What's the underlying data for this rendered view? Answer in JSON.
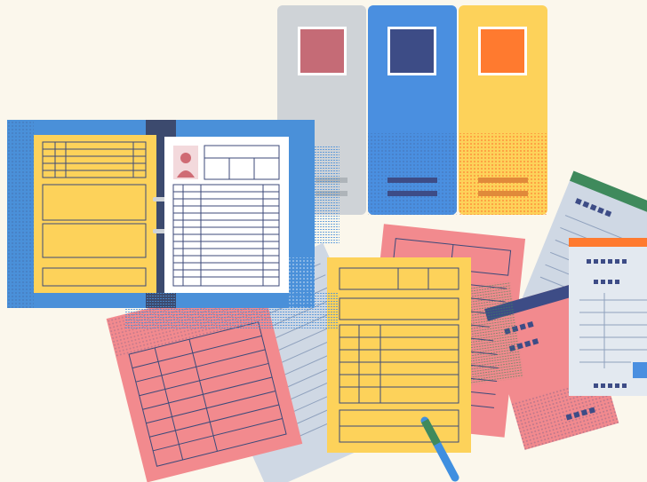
{
  "illustration": {
    "subject": "paperwork",
    "colors": {
      "background": "#fbf7ec",
      "binder_blue": "#4a90d9",
      "binder_dark": "#3c4a6e",
      "folder_gray": "#cfd3d7",
      "folder_blue": "#4a8fe0",
      "folder_yellow": "#fdd25a",
      "sheet_pink": "#f28a8e",
      "sheet_yellow": "#fdd25a",
      "sheet_gray": "#cfd8e4",
      "sheet_white": "#ffffff",
      "line_navy": "#3c4a7a",
      "accent_red": "#cf6b74",
      "accent_navy": "#3d4c86",
      "accent_orange": "#ff7a2f",
      "accent_green": "#3f8a5c",
      "pen_blue": "#3f8fe0"
    },
    "objects": [
      "folder-gray",
      "folder-blue",
      "folder-yellow",
      "open-binder",
      "form-yellow",
      "form-pink",
      "form-gray",
      "ticket-green",
      "ticket-orange",
      "pen"
    ]
  }
}
